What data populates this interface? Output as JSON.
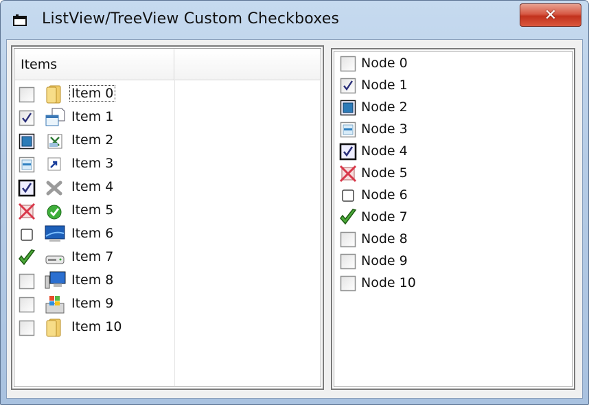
{
  "window": {
    "title": "ListView/TreeView Custom Checkboxes",
    "close_label": "✕"
  },
  "listview": {
    "column_header": "Items",
    "items": [
      {
        "label": "Item 0",
        "check": "unchecked",
        "icon": "folder-icon"
      },
      {
        "label": "Item 1",
        "check": "checked",
        "icon": "document-window-icon"
      },
      {
        "label": "Item 2",
        "check": "indeterminate",
        "icon": "excel-doc-icon"
      },
      {
        "label": "Item 3",
        "check": "partial",
        "icon": "shortcut-icon"
      },
      {
        "label": "Item 4",
        "check": "checked-bold",
        "icon": "delete-x-icon"
      },
      {
        "label": "Item 5",
        "check": "excluded",
        "icon": "green-check-icon"
      },
      {
        "label": "Item 6",
        "check": "small-unchecked",
        "icon": "monitor-icon"
      },
      {
        "label": "Item 7",
        "check": "green-check",
        "icon": "drive-icon"
      },
      {
        "label": "Item 8",
        "check": "unchecked",
        "icon": "computer-icon"
      },
      {
        "label": "Item 9",
        "check": "unchecked",
        "icon": "windows-program-icon"
      },
      {
        "label": "Item 10",
        "check": "unchecked",
        "icon": "folder-icon"
      }
    ]
  },
  "treeview": {
    "nodes": [
      {
        "label": "Node 0",
        "check": "unchecked"
      },
      {
        "label": "Node 1",
        "check": "checked"
      },
      {
        "label": "Node 2",
        "check": "indeterminate"
      },
      {
        "label": "Node 3",
        "check": "partial"
      },
      {
        "label": "Node 4",
        "check": "checked-bold"
      },
      {
        "label": "Node 5",
        "check": "excluded"
      },
      {
        "label": "Node 6",
        "check": "small-unchecked"
      },
      {
        "label": "Node 7",
        "check": "green-check"
      },
      {
        "label": "Node 8",
        "check": "unchecked"
      },
      {
        "label": "Node 9",
        "check": "unchecked"
      },
      {
        "label": "Node 10",
        "check": "unchecked"
      }
    ]
  }
}
